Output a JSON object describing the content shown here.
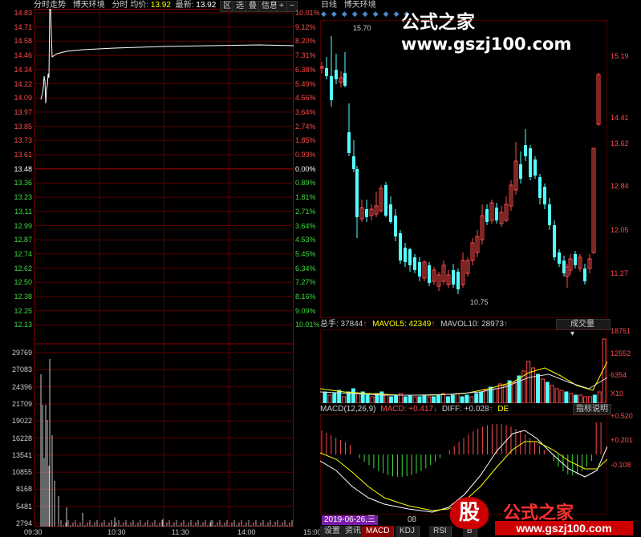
{
  "left_header": {
    "title": "分时走势",
    "stock": "博天环境",
    "avg_label": "分时 均价:",
    "avg_value": "13.92",
    "latest_label": "最新:",
    "latest_value": "13.92",
    "btn_zone": "区",
    "btn_option": "选",
    "btn_overlay": "叠",
    "btn_info": "信息",
    "btn_plus": "+",
    "btn_minus": "−"
  },
  "price_axis_left": [
    "14.83",
    "14.71",
    "14.58",
    "14.46",
    "14.34",
    "14.22",
    "14.09",
    "13.97",
    "13.85",
    "13.73",
    "13.61",
    "13.48",
    "13.36",
    "13.23",
    "13.11",
    "12.99",
    "12.87",
    "12.74",
    "12.62",
    "12.50",
    "12.38",
    "12.25",
    "12.13"
  ],
  "pct_axis_right": [
    "10.01%",
    "9.12%",
    "8.20%",
    "7.31%",
    "6.38%",
    "5.49%",
    "4.56%",
    "3.64%",
    "2.74%",
    "1.85%",
    "0.93%",
    "0.00%",
    "0.89%",
    "1.81%",
    "2.71%",
    "3.64%",
    "4.53%",
    "5.45%",
    "6.34%",
    "7.27%",
    "8.16%",
    "9.09%",
    "10.01%"
  ],
  "volume_axis_left": [
    "29769",
    "27083",
    "24396",
    "21709",
    "19022",
    "16228",
    "13541",
    "10855",
    "8168",
    "5481",
    "2794"
  ],
  "time_axis": [
    "09:30",
    "10:30",
    "11:30",
    "14:00",
    "15:00"
  ],
  "right_header": {
    "period": "日线",
    "stock": "博天环境"
  },
  "kline_axis": [
    "15.19",
    "14.41",
    "13.62",
    "12.84",
    "12.05",
    "11.27"
  ],
  "kline_high_label": "15.70",
  "kline_low_label": "10.75",
  "vol_header": {
    "total_label": "总手: 37844",
    "ma5_label": "MAVOL5: 42349",
    "ma10_label": "MAVOL10: 28973",
    "dropdown": "成交量"
  },
  "vol_axis": [
    "18751",
    "12552",
    "6354",
    "X10"
  ],
  "macd_header": {
    "params": "MACD(12,26,9)",
    "macd": "MACD: +0.417",
    "diff": "DIFF: +0.028",
    "dea": "DE",
    "help": "指标说明"
  },
  "macd_axis": [
    "+0.520",
    "+0.201",
    "-0.108"
  ],
  "date_label": "2019-06-26,三",
  "date_extra": "08",
  "tabs": [
    "设置",
    "资讯",
    "MACD",
    "KDJ",
    "RSI",
    "B"
  ],
  "watermark_top": "公式之家 www.gszj100.com",
  "watermark_bottom_logo": "股",
  "watermark_bottom": "公式之家",
  "watermark_bottom_url": "www.gszj100.com",
  "colors": {
    "up": "#ff4a4a",
    "down": "#54ffff",
    "axis": "#8b0000",
    "yellow": "#ffff00",
    "white": "#ffffff"
  }
}
